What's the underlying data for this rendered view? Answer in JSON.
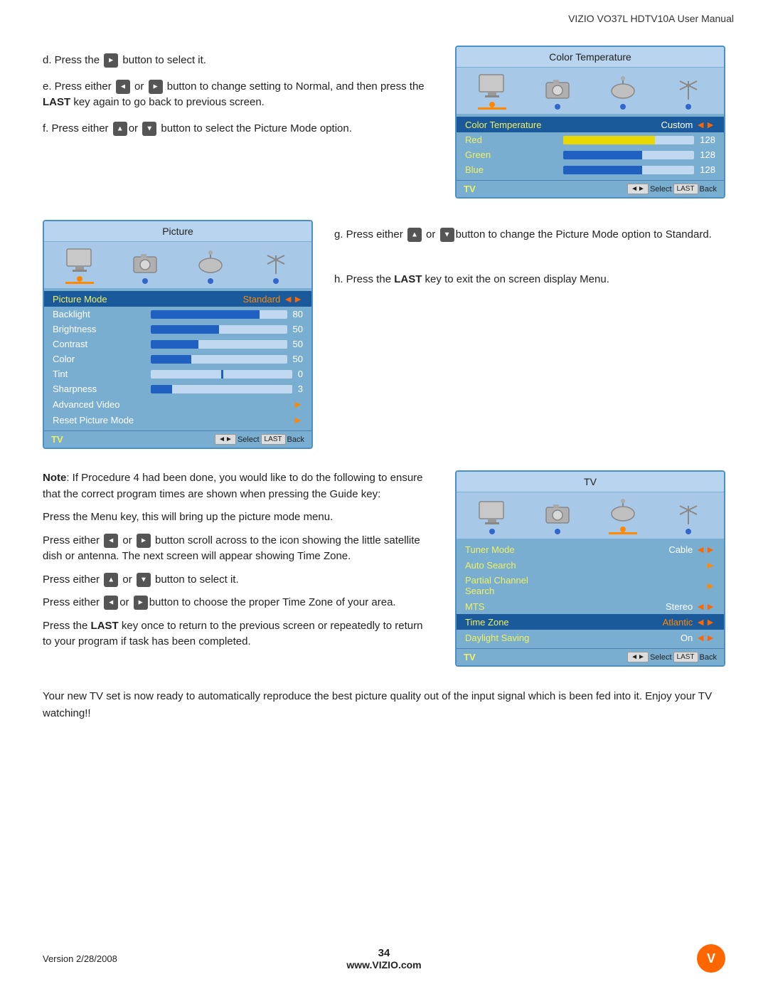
{
  "header": {
    "title": "VIZIO VO37L HDTV10A User Manual"
  },
  "steps": {
    "d": "d. Press the   button to select it.",
    "e": "e. Press either   or   button to change setting to Normal, and then press the LAST key again to go back to previous screen.",
    "f": "f. Press either  or  button to select the Picture Mode option.",
    "g": "g. Press either   or  button to change the Picture Mode option to Standard.",
    "h": "h. Press the LAST key to exit the on screen display Menu.",
    "note_title": "Note",
    "note_body": ": If Procedure 4 had been done, you would like to do the following to ensure that the correct program times are shown when pressing the Guide key:",
    "p1": "Press the Menu key, this will bring up the picture mode menu.",
    "p2": "Press either   or   button scroll across to the icon showing the little satellite dish or antenna. The next screen will appear showing Time Zone.",
    "p3": "Press either   or   button to select it.",
    "p4": "Press either  or  button to choose the proper Time Zone of your area.",
    "p5": "Press the LAST key once to return to the previous screen or repeatedly to return to your program if task has been completed.",
    "final": "Your new TV set is now ready to automatically reproduce the best picture quality out of the input signal which is been fed into it. Enjoy your TV watching!!"
  },
  "color_temp_panel": {
    "title": "Color Temperature",
    "rows": [
      {
        "label": "Color Temperature",
        "value": "Custom",
        "type": "value",
        "arrow": "◄►"
      },
      {
        "label": "Red",
        "value": "128",
        "type": "bar",
        "bar_type": "yellow",
        "bar_pct": 70
      },
      {
        "label": "Green",
        "value": "128",
        "type": "bar",
        "bar_type": "blue",
        "bar_pct": 60
      },
      {
        "label": "Blue",
        "value": "128",
        "type": "bar",
        "bar_type": "blue",
        "bar_pct": 60
      }
    ],
    "footer_label": "TV",
    "footer_keys": "Select Back"
  },
  "picture_panel": {
    "title": "Picture",
    "rows": [
      {
        "label": "Picture Mode",
        "value": "Standard",
        "type": "value",
        "arrow": "◄►",
        "highlighted": true
      },
      {
        "label": "Backlight",
        "value": "80",
        "type": "bar",
        "bar_type": "blue",
        "bar_pct": 80
      },
      {
        "label": "Brightness",
        "value": "50",
        "type": "bar",
        "bar_type": "blue",
        "bar_pct": 50
      },
      {
        "label": "Contrast",
        "value": "50",
        "type": "bar",
        "bar_type": "blue",
        "bar_pct": 35
      },
      {
        "label": "Color",
        "value": "50",
        "type": "bar",
        "bar_type": "blue",
        "bar_pct": 30
      },
      {
        "label": "Tint",
        "value": "0",
        "type": "bar",
        "bar_type": "dot",
        "bar_pct": 50
      },
      {
        "label": "Sharpness",
        "value": "3",
        "type": "bar",
        "bar_type": "blue",
        "bar_pct": 15
      },
      {
        "label": "Advanced Video",
        "value": "",
        "type": "arrow"
      },
      {
        "label": "Reset Picture Mode",
        "value": "",
        "type": "arrow"
      }
    ],
    "footer_label": "TV",
    "footer_keys": "Select Back"
  },
  "tv_panel": {
    "title": "TV",
    "rows": [
      {
        "label": "Tuner Mode",
        "value": "Cable",
        "type": "value",
        "arrow": "◄►"
      },
      {
        "label": "Auto Search",
        "value": "",
        "type": "arrow"
      },
      {
        "label": "Partial Channel Search",
        "value": "",
        "type": "arrow"
      },
      {
        "label": "MTS",
        "value": "Stereo",
        "type": "value",
        "arrow": "◄►"
      },
      {
        "label": "Time Zone",
        "value": "Atlantic",
        "type": "value",
        "arrow": "◄►",
        "highlighted": true
      },
      {
        "label": "Daylight Saving",
        "value": "On",
        "type": "value",
        "arrow": "◄►"
      }
    ],
    "footer_label": "TV",
    "footer_keys": "Select Back"
  },
  "footer": {
    "version": "Version 2/28/2008",
    "page": "34",
    "url": "www.VIZIO.com",
    "logo": "V"
  }
}
